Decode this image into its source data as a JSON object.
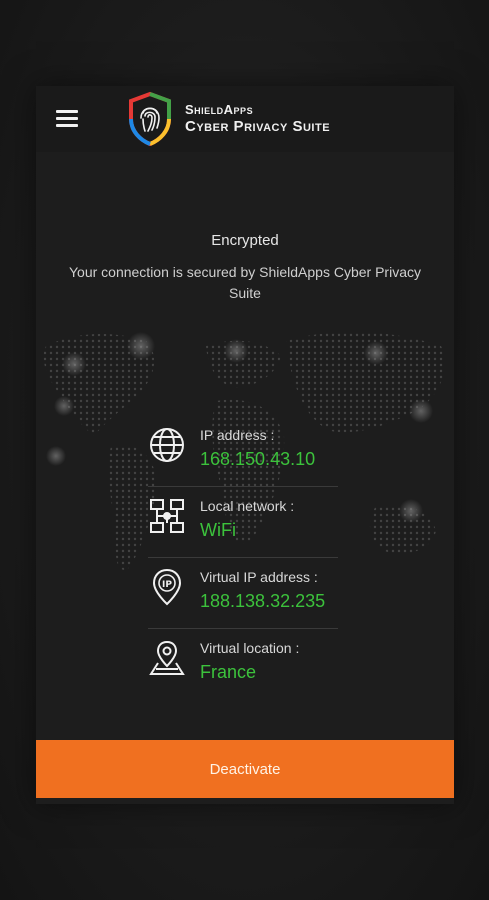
{
  "app": {
    "brand_line1": "ShieldApps",
    "brand_line2": "Cyber Privacy Suite",
    "menu_icon": "hamburger-menu-icon",
    "logo_icon": "fingerprint-shield-icon"
  },
  "status": {
    "title": "Encrypted",
    "description": "Your connection is secured by ShieldApps Cyber Privacy Suite"
  },
  "info": {
    "items": [
      {
        "icon": "globe-icon",
        "label": "IP address :",
        "value": "168.150.43.10"
      },
      {
        "icon": "network-icon",
        "label": "Local network :",
        "value": "WiFi"
      },
      {
        "icon": "ip-location-pin-icon",
        "label": "Virtual IP address :",
        "value": "188.138.32.235"
      },
      {
        "icon": "map-location-icon",
        "label": "Virtual location :",
        "value": "France"
      }
    ]
  },
  "actions": {
    "deactivate_label": "Deactivate"
  },
  "colors": {
    "accent": "#f07020",
    "value_green": "#3cc23c",
    "background": "#1d1d1d"
  }
}
